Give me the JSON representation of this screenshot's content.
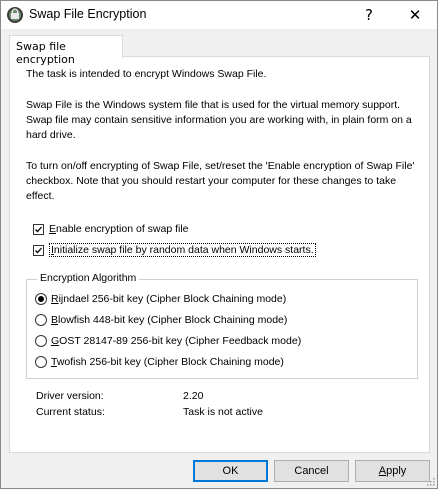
{
  "window": {
    "title": "Swap File Encryption",
    "help_glyph": "?",
    "close_glyph": "✕"
  },
  "tab": {
    "label": "Swap file encryption"
  },
  "text": {
    "p1": "The task is intended to encrypt Windows Swap File.",
    "p2": "Swap File is the Windows system file that is used for the virtual memory support. Swap file may contain sensitive information you are working with, in plain form on a hard drive.",
    "p3": "To turn on/off encrypting of Swap File, set/reset the 'Enable encryption of Swap File' checkbox. Note that you should restart your computer for these changes to take effect."
  },
  "checkboxes": [
    {
      "mnemonic": "E",
      "rest": "nable encryption of swap file",
      "checked": true
    },
    {
      "mnemonic": "I",
      "rest": "nitialize swap file by random data when Windows starts.",
      "checked": true
    }
  ],
  "algorithm": {
    "label": "Encryption Algorithm",
    "options": [
      {
        "mnemonic": "R",
        "rest": "ijndael 256-bit key (Cipher Block Chaining mode)",
        "selected": true
      },
      {
        "mnemonic": "B",
        "rest": "lowfish 448-bit key (Cipher Block Chaining mode)",
        "selected": false
      },
      {
        "mnemonic": "G",
        "rest": "OST 28147-89 256-bit key (Cipher Feedback mode)",
        "selected": false
      },
      {
        "mnemonic": "T",
        "rest": "wofish 256-bit key (Cipher Block Chaining mode)",
        "selected": false
      }
    ]
  },
  "info": {
    "driver_label": "Driver version:",
    "driver_value": "2.20",
    "status_label": "Current status:",
    "status_value": "Task is not active"
  },
  "buttons": {
    "ok": "OK",
    "cancel": "Cancel",
    "apply_mnemonic": "A",
    "apply_rest": "pply"
  },
  "colors": {
    "accent": "#0078d7"
  }
}
